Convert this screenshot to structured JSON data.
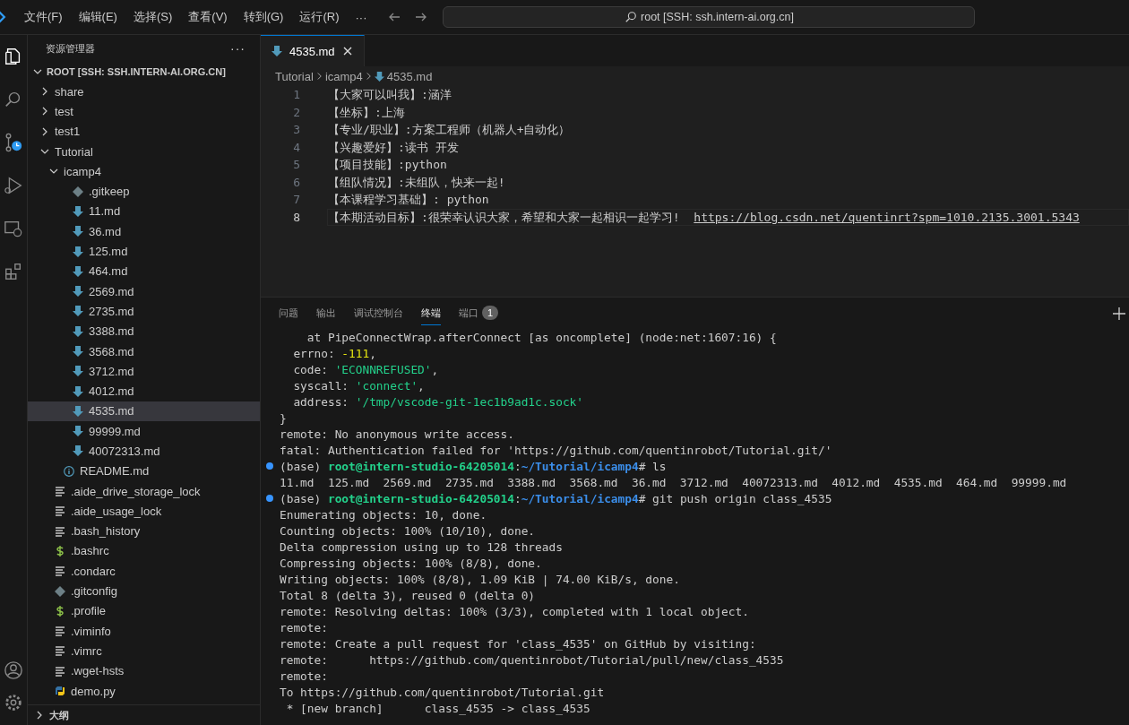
{
  "menu": [
    "文件(F)",
    "编辑(E)",
    "选择(S)",
    "查看(V)",
    "转到(G)",
    "运行(R)",
    "···"
  ],
  "command_center": {
    "text": "root [SSH: ssh.intern-ai.org.cn]"
  },
  "activity_bar": [
    {
      "kind": "files",
      "selected": true
    },
    {
      "kind": "search",
      "selected": false
    },
    {
      "kind": "scm",
      "selected": false
    },
    {
      "kind": "debug",
      "selected": false
    },
    {
      "kind": "remote",
      "selected": false
    },
    {
      "kind": "extensions",
      "selected": false
    }
  ],
  "sidebar": {
    "title": "资源管理器",
    "more": "···",
    "tree": {
      "label": "ROOT [SSH: SSH.INTERN-AI.ORG.CN]",
      "expanded": true,
      "children": [
        {
          "label": "share",
          "expanded": false,
          "selected": false
        },
        {
          "label": "test",
          "expanded": false,
          "selected": false
        },
        {
          "label": "test1",
          "expanded": false,
          "selected": false
        },
        {
          "label": "Tutorial",
          "expanded": true,
          "selected": false,
          "children": [
            {
              "label": "icamp4",
              "expanded": true,
              "selected": false,
              "children": [
                {
                  "label": ".gitkeep",
                  "kind": "git",
                  "selected": false
                },
                {
                  "label": "11.md",
                  "kind": "markdown",
                  "selected": false
                },
                {
                  "label": "36.md",
                  "kind": "markdown",
                  "selected": false
                },
                {
                  "label": "125.md",
                  "kind": "markdown",
                  "selected": false
                },
                {
                  "label": "464.md",
                  "kind": "markdown",
                  "selected": false
                },
                {
                  "label": "2569.md",
                  "kind": "markdown",
                  "selected": false
                },
                {
                  "label": "2735.md",
                  "kind": "markdown",
                  "selected": false
                },
                {
                  "label": "3388.md",
                  "kind": "markdown",
                  "selected": false
                },
                {
                  "label": "3568.md",
                  "kind": "markdown",
                  "selected": false
                },
                {
                  "label": "3712.md",
                  "kind": "markdown",
                  "selected": false
                },
                {
                  "label": "4012.md",
                  "kind": "markdown",
                  "selected": false
                },
                {
                  "label": "4535.md",
                  "kind": "markdown",
                  "selected": true
                },
                {
                  "label": "99999.md",
                  "kind": "markdown",
                  "selected": false
                },
                {
                  "label": "40072313.md",
                  "kind": "markdown",
                  "selected": false
                }
              ]
            },
            {
              "label": "README.md",
              "kind": "info",
              "selected": false
            }
          ]
        },
        {
          "label": ".aide_drive_storage_lock",
          "kind": "text",
          "selected": false
        },
        {
          "label": ".aide_usage_lock",
          "kind": "text",
          "selected": false
        },
        {
          "label": ".bash_history",
          "kind": "text",
          "selected": false
        },
        {
          "label": ".bashrc",
          "kind": "shell",
          "selected": false
        },
        {
          "label": ".condarc",
          "kind": "text",
          "selected": false
        },
        {
          "label": ".gitconfig",
          "kind": "git",
          "selected": false
        },
        {
          "label": ".profile",
          "kind": "shell",
          "selected": false
        },
        {
          "label": ".viminfo",
          "kind": "text",
          "selected": false
        },
        {
          "label": ".vimrc",
          "kind": "text",
          "selected": false
        },
        {
          "label": ".wget-hsts",
          "kind": "text",
          "selected": false
        },
        {
          "label": "demo.py",
          "kind": "python",
          "selected": false
        }
      ]
    },
    "outline": {
      "label": "大纲",
      "expanded": false
    }
  },
  "editor": {
    "tabs": [
      {
        "label": "4535.md",
        "selected": true
      }
    ],
    "breadcrumbs": [
      "Tutorial",
      "icamp4",
      "4535.md"
    ],
    "lines": [
      {
        "number": "1",
        "text": "【大家可以叫我】:涵洋",
        "current": false
      },
      {
        "number": "2",
        "text": "【坐标】:上海",
        "current": false
      },
      {
        "number": "3",
        "text": "【专业/职业】:方案工程师（机器人+自动化）",
        "current": false
      },
      {
        "number": "4",
        "text": "【兴趣爱好】:读书 开发",
        "current": false
      },
      {
        "number": "5",
        "text": "【项目技能】:python",
        "current": false
      },
      {
        "number": "6",
        "text": "【组队情况】:未组队，快来一起!",
        "current": false
      },
      {
        "number": "7",
        "text": "【本课程学习基础】: python",
        "current": false
      },
      {
        "number": "8",
        "text": "【本期活动目标】:很荣幸认识大家，希望和大家一起相识一起学习!  ",
        "link": "https://blog.csdn.net/quentinrt?spm=1010.2135.3001.5343",
        "current": true
      }
    ]
  },
  "panel": {
    "tabs": [
      {
        "label": "问题",
        "selected": false
      },
      {
        "label": "输出",
        "selected": false
      },
      {
        "label": "调试控制台",
        "selected": false
      },
      {
        "label": "终端",
        "selected": true
      },
      {
        "label": "端口",
        "selected": false,
        "badge": "1"
      }
    ],
    "terminal": [
      {
        "segments": [
          {
            "text": "    at PipeConnectWrap.afterConnect [as oncomplete] (node:net:1607:16) {",
            "kind": "plain"
          }
        ]
      },
      {
        "segments": [
          {
            "text": "  errno: ",
            "kind": "plain"
          },
          {
            "text": "-111",
            "kind": "num"
          },
          {
            "text": ",",
            "kind": "plain"
          }
        ]
      },
      {
        "segments": [
          {
            "text": "  code: ",
            "kind": "plain"
          },
          {
            "text": "'ECONNREFUSED'",
            "kind": "str"
          },
          {
            "text": ",",
            "kind": "plain"
          }
        ]
      },
      {
        "segments": [
          {
            "text": "  syscall: ",
            "kind": "plain"
          },
          {
            "text": "'connect'",
            "kind": "str"
          },
          {
            "text": ",",
            "kind": "plain"
          }
        ]
      },
      {
        "segments": [
          {
            "text": "  address: ",
            "kind": "plain"
          },
          {
            "text": "'/tmp/vscode-git-1ec1b9ad1c.sock'",
            "kind": "str"
          }
        ]
      },
      {
        "segments": [
          {
            "text": "}",
            "kind": "plain"
          }
        ]
      },
      {
        "segments": [
          {
            "text": "remote: No anonymous write access.",
            "kind": "plain"
          }
        ]
      },
      {
        "segments": [
          {
            "text": "fatal: Authentication failed for 'https://github.com/quentinrobot/Tutorial.git/'",
            "kind": "plain"
          }
        ]
      },
      {
        "dot": true,
        "segments": [
          {
            "text": "(base) ",
            "kind": "plain"
          },
          {
            "text": "root@intern-studio-64205014",
            "kind": "user"
          },
          {
            "text": ":",
            "kind": "plain"
          },
          {
            "text": "~/Tutorial/icamp4",
            "kind": "path"
          },
          {
            "text": "# ls",
            "kind": "plain"
          }
        ]
      },
      {
        "segments": [
          {
            "text": "11.md  125.md  2569.md  2735.md  3388.md  3568.md  36.md  3712.md  40072313.md  4012.md  4535.md  464.md  99999.md",
            "kind": "plain"
          }
        ]
      },
      {
        "dot": true,
        "segments": [
          {
            "text": "(base) ",
            "kind": "plain"
          },
          {
            "text": "root@intern-studio-64205014",
            "kind": "user"
          },
          {
            "text": ":",
            "kind": "plain"
          },
          {
            "text": "~/Tutorial/icamp4",
            "kind": "path"
          },
          {
            "text": "# git push origin class_4535",
            "kind": "plain"
          }
        ]
      },
      {
        "segments": [
          {
            "text": "Enumerating objects: 10, done.",
            "kind": "plain"
          }
        ]
      },
      {
        "segments": [
          {
            "text": "Counting objects: 100% (10/10), done.",
            "kind": "plain"
          }
        ]
      },
      {
        "segments": [
          {
            "text": "Delta compression using up to 128 threads",
            "kind": "plain"
          }
        ]
      },
      {
        "segments": [
          {
            "text": "Compressing objects: 100% (8/8), done.",
            "kind": "plain"
          }
        ]
      },
      {
        "segments": [
          {
            "text": "Writing objects: 100% (8/8), 1.09 KiB | 74.00 KiB/s, done.",
            "kind": "plain"
          }
        ]
      },
      {
        "segments": [
          {
            "text": "Total 8 (delta 3), reused 0 (delta 0)",
            "kind": "plain"
          }
        ]
      },
      {
        "segments": [
          {
            "text": "remote: Resolving deltas: 100% (3/3), completed with 1 local object.",
            "kind": "plain"
          }
        ]
      },
      {
        "segments": [
          {
            "text": "remote:",
            "kind": "plain"
          }
        ]
      },
      {
        "segments": [
          {
            "text": "remote: Create a pull request for 'class_4535' on GitHub by visiting:",
            "kind": "plain"
          }
        ]
      },
      {
        "segments": [
          {
            "text": "remote:      https://github.com/quentinrobot/Tutorial/pull/new/class_4535",
            "kind": "plain"
          }
        ]
      },
      {
        "segments": [
          {
            "text": "remote:",
            "kind": "plain"
          }
        ]
      },
      {
        "segments": [
          {
            "text": "To https://github.com/quentinrobot/Tutorial.git",
            "kind": "plain"
          }
        ]
      },
      {
        "segments": [
          {
            "text": " * [new branch]      class_4535 -> class_4535",
            "kind": "plain"
          }
        ]
      }
    ]
  }
}
